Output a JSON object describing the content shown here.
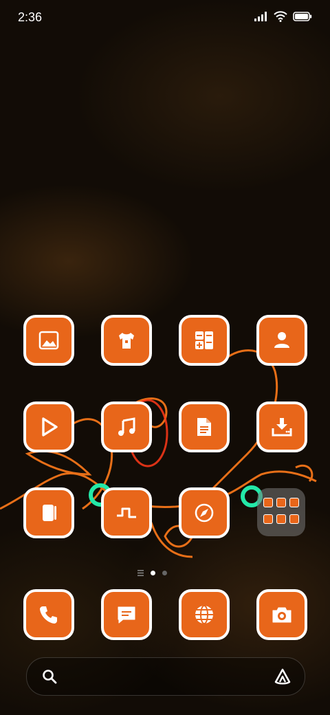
{
  "status_bar": {
    "time": "2:36",
    "icons": [
      "signal-icon",
      "wifi-icon",
      "battery-icon"
    ]
  },
  "theme": {
    "accent": "#e8661a",
    "border": "#ffffff"
  },
  "home_grid": {
    "rows": [
      [
        "gallery-icon",
        "theme-shirt-icon",
        "calculator-icon",
        "contacts-icon"
      ],
      [
        "video-player-icon",
        "music-icon",
        "notes-icon",
        "downloads-icon"
      ],
      [
        "app-notebook-icon",
        "recorder-icon",
        "compass-icon",
        "app-folder"
      ]
    ],
    "folder_contents": [
      "mini-app-icon",
      "mini-app-icon",
      "mini-app-icon",
      "mini-app-icon",
      "mini-app-icon",
      "mini-app-icon"
    ]
  },
  "pages": {
    "count": 2,
    "current": 1
  },
  "dock": [
    "phone-icon",
    "messages-icon",
    "browser-icon",
    "camera-icon"
  ],
  "search_bar": {
    "icons": [
      "search-icon",
      "assistant-icon"
    ]
  }
}
